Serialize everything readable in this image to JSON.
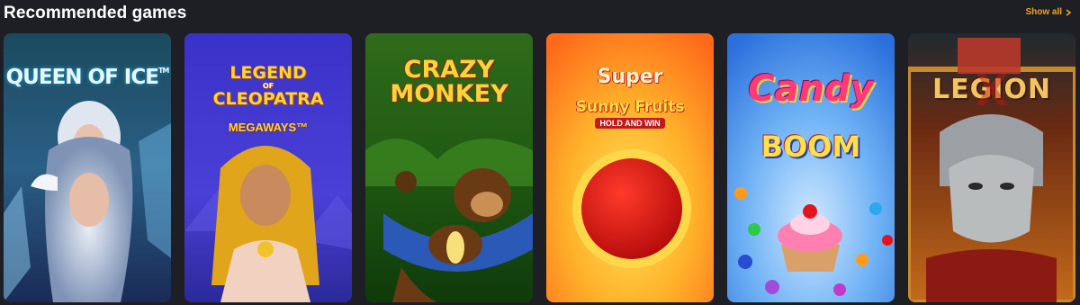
{
  "header": {
    "title": "Recommended games",
    "show_all_label": "Show all"
  },
  "colors": {
    "accent": "#f2a21c",
    "background": "#1e1f24"
  },
  "games": [
    {
      "title": "QUEEN OF ICE",
      "trademark": "TM"
    },
    {
      "title_line1": "LEGEND",
      "title_of": "OF",
      "title_line2": "CLEOPATRA",
      "subtitle": "MEGAWAYS™"
    },
    {
      "title_line1": "CRAZY",
      "title_line2": "MONKEY"
    },
    {
      "title_line1": "Super",
      "title_line2": "Sunny Fruits",
      "subtitle": "HOLD AND WIN"
    },
    {
      "title_line1": "Candy",
      "title_line2": "BOOM"
    },
    {
      "title": "LEGION",
      "numeral": "X"
    }
  ]
}
